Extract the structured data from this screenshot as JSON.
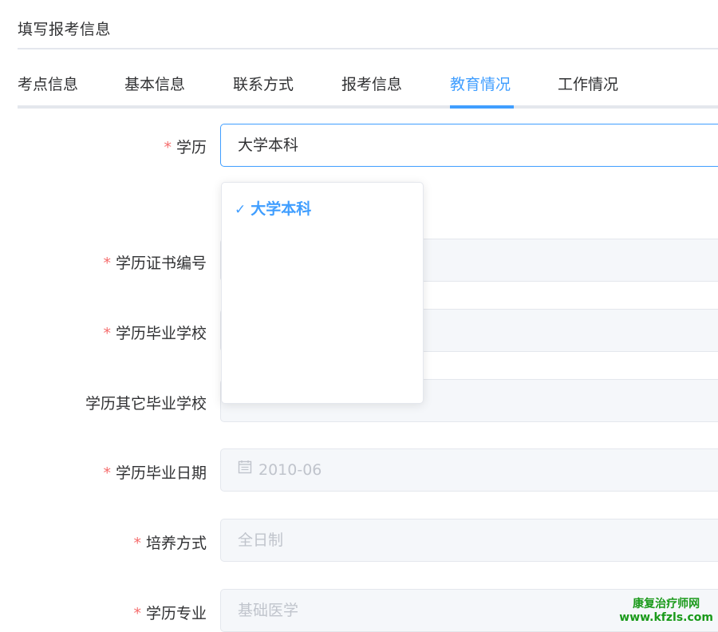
{
  "page": {
    "title": "填写报考信息"
  },
  "tabs": [
    {
      "label": "考点信息"
    },
    {
      "label": "基本信息"
    },
    {
      "label": "联系方式"
    },
    {
      "label": "报考信息"
    },
    {
      "label": "教育情况",
      "active": true
    },
    {
      "label": "工作情况"
    }
  ],
  "form": {
    "education": {
      "label": "学历",
      "required_mark": "*",
      "value": "大学本科"
    },
    "dropdown": {
      "options": [
        {
          "label": "大学本科",
          "selected": true,
          "check": "✓"
        }
      ]
    },
    "cert_no": {
      "label": "学历证书编号",
      "required_mark": "*",
      "value": ""
    },
    "school": {
      "label": "学历毕业学校",
      "required_mark": "*",
      "value": ""
    },
    "other_school": {
      "label": "学历其它毕业学校",
      "value": ""
    },
    "grad_date": {
      "label": "学历毕业日期",
      "required_mark": "*",
      "value": "2010-06"
    },
    "study_mode": {
      "label": "培养方式",
      "required_mark": "*",
      "value": "全日制"
    },
    "major": {
      "label": "学历专业",
      "required_mark": "*",
      "value": "基础医学"
    }
  },
  "watermark": {
    "line1": "康复治疗师网",
    "line2": "www.kfzls.com"
  },
  "colors": {
    "accent": "#409eff",
    "required": "#f56c6c",
    "disabled_bg": "#f5f7fa",
    "border": "#e4e7ed"
  }
}
